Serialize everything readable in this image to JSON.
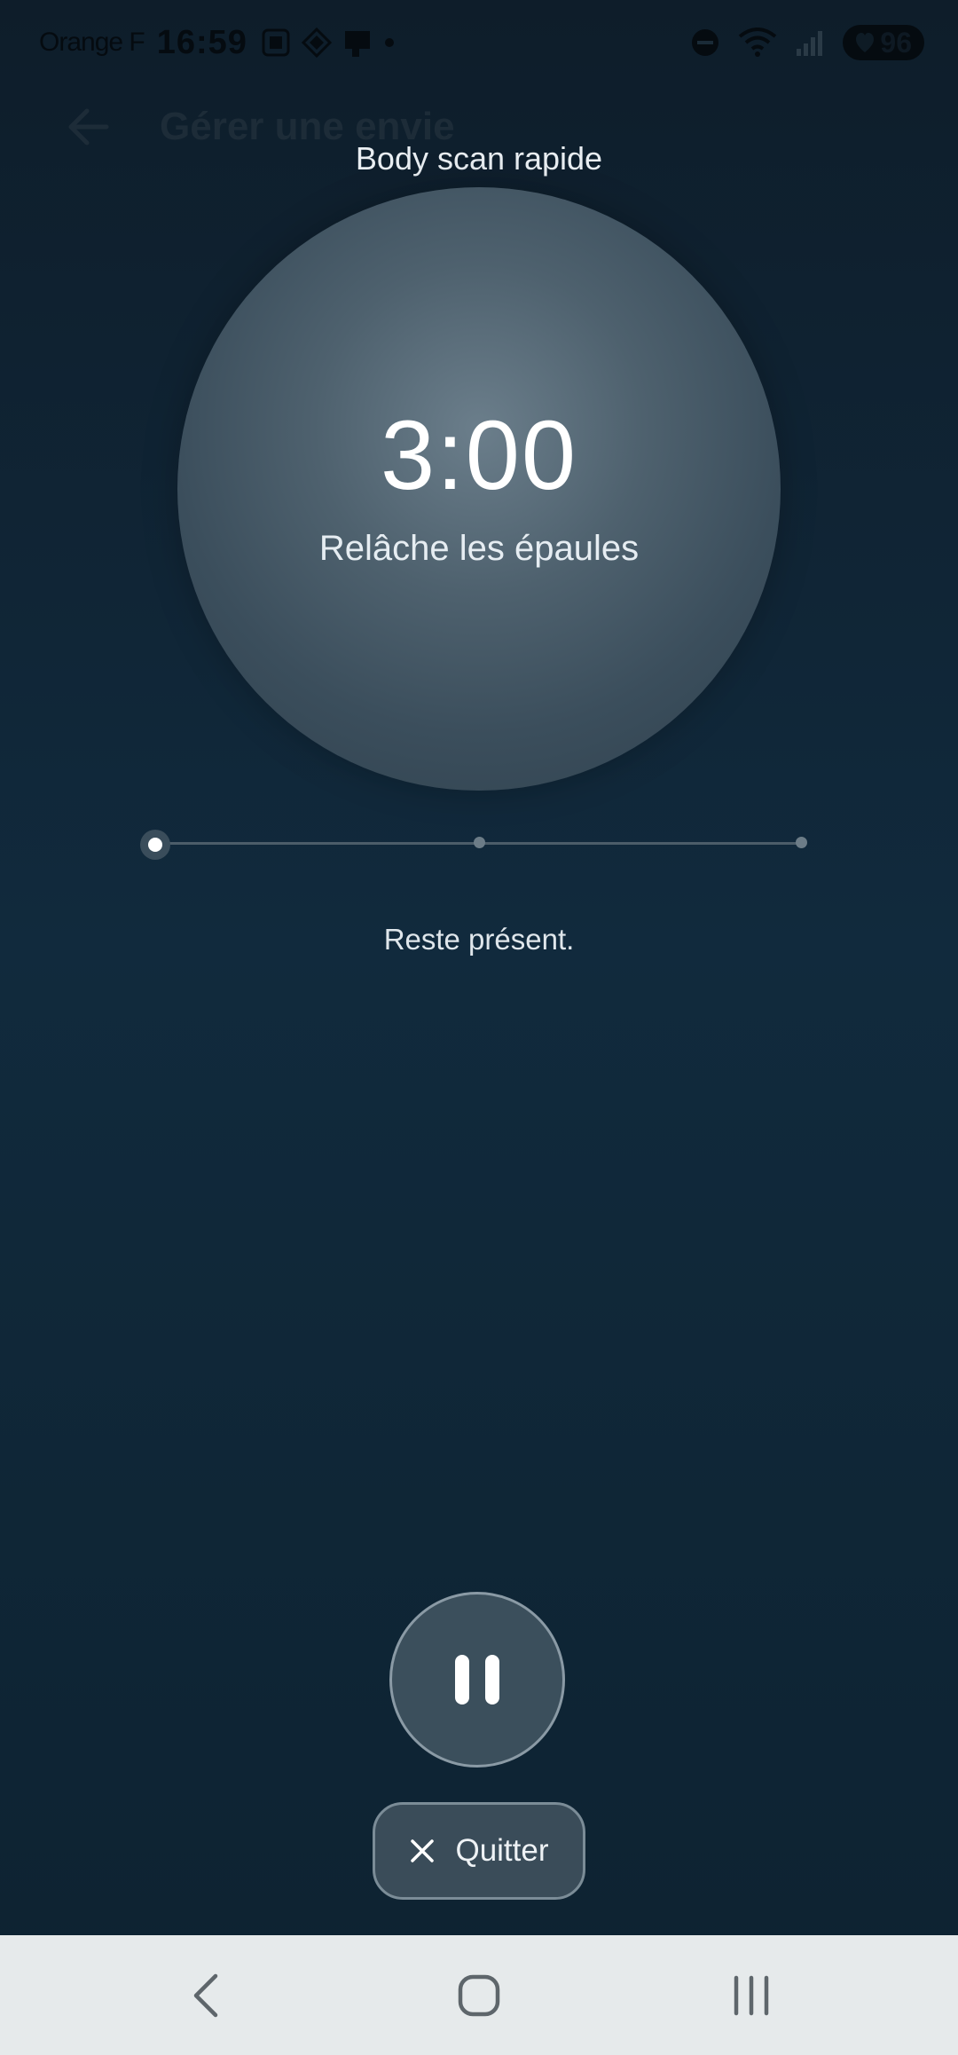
{
  "status_bar": {
    "carrier": "Orange F",
    "time": "16:59",
    "battery": "96",
    "icons": [
      "screenshot-icon",
      "app-icon",
      "cast-icon",
      "dot-icon",
      "dnd-icon",
      "wifi-icon",
      "signal-icon",
      "battery-icon"
    ]
  },
  "background_header": {
    "title": "Gérer une envie"
  },
  "session": {
    "title": "Body scan rapide",
    "timer": "3:00",
    "instruction": "Relâche les épaules",
    "message": "Reste présent.",
    "progress": {
      "current_step": 1,
      "total_steps": 3
    }
  },
  "controls": {
    "quit_label": "Quitter"
  },
  "colors": {
    "background_top": "#0e1d2a",
    "background_mid": "#112a3d",
    "orb": "#4e616e",
    "button": "#3b4f5c",
    "nav_bar": "#e6eaeb"
  }
}
